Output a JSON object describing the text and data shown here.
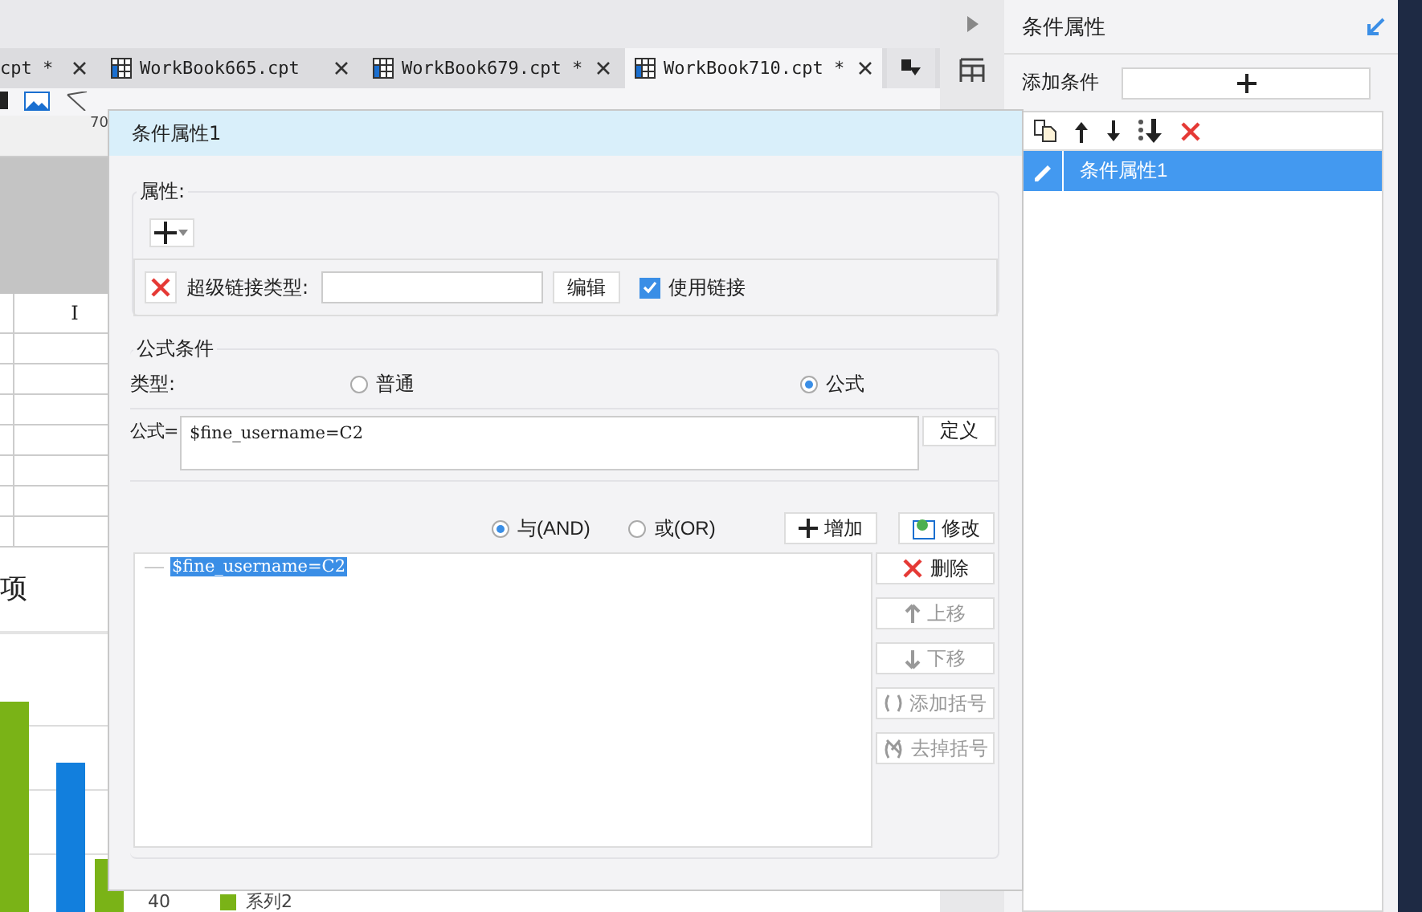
{
  "editor_tabs": [
    {
      "label": "cpt *",
      "selected": false
    },
    {
      "label": "WorkBook665.cpt",
      "selected": false
    },
    {
      "label": "WorkBook679.cpt *",
      "selected": false
    },
    {
      "label": "WorkBook710.cpt *",
      "selected": true
    }
  ],
  "ruler": {
    "mark": "70"
  },
  "sheet": {
    "column_header": "I"
  },
  "chart": {
    "title_fragment": "项",
    "axis_label": "40",
    "legend": "系列2"
  },
  "dialog": {
    "title": "条件属性1",
    "attributes": {
      "legend": "属性:",
      "hyperlink_label": "超级链接类型:",
      "edit_button": "编辑",
      "use_link": {
        "label": "使用链接",
        "checked": true
      }
    },
    "formula": {
      "legend": "公式条件",
      "type_label": "类型:",
      "types": [
        {
          "label": "普通",
          "selected": false
        },
        {
          "label": "公式",
          "selected": true
        }
      ],
      "formula_label": "公式=",
      "formula_value": "$fine_username=C2",
      "define_button": "定义",
      "logic": [
        {
          "label": "与(AND)",
          "selected": true
        },
        {
          "label": "或(OR)",
          "selected": false
        }
      ],
      "add_button": "增加",
      "modify_button": "修改",
      "conditions": [
        {
          "text": "$fine_username=C2",
          "selected": true
        }
      ],
      "side_buttons": [
        {
          "kind": "delete",
          "label": "删除",
          "disabled": false
        },
        {
          "kind": "up",
          "label": "上移",
          "disabled": true
        },
        {
          "kind": "down",
          "label": "下移",
          "disabled": true
        },
        {
          "kind": "add-paren",
          "label": "添加括号",
          "disabled": true
        },
        {
          "kind": "remove-paren",
          "label": "去掉括号",
          "disabled": true
        }
      ]
    }
  },
  "panel": {
    "title": "条件属性",
    "add_label": "添加条件",
    "items": [
      {
        "label": "条件属性1",
        "selected": true
      }
    ]
  }
}
